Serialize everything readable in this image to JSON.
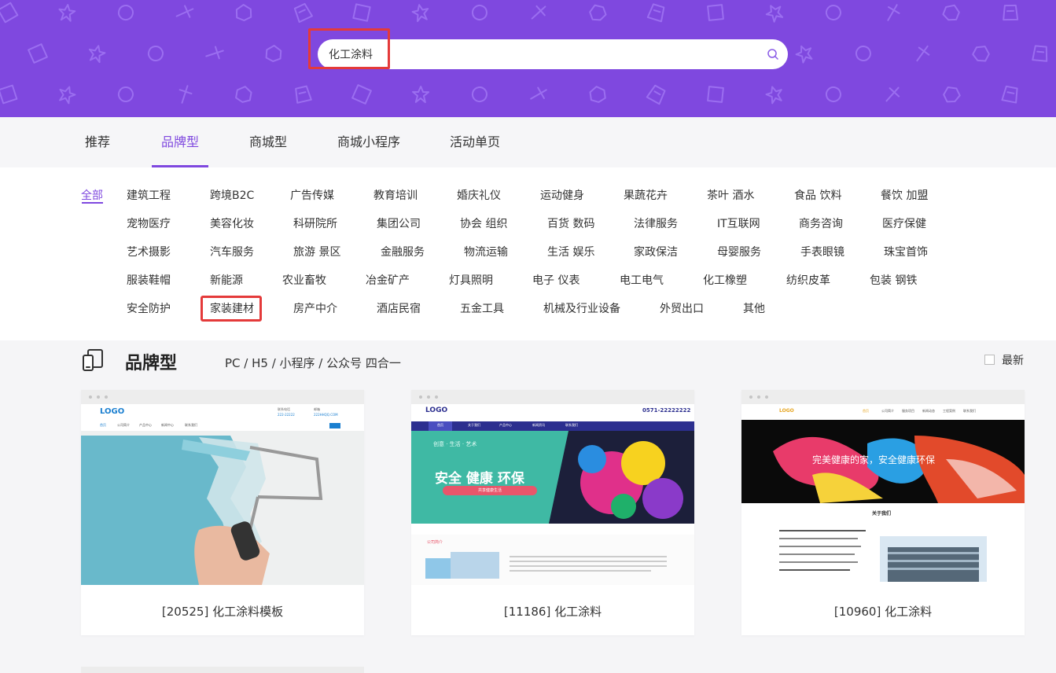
{
  "search": {
    "value": "化工涂料"
  },
  "tabs": [
    {
      "label": "推荐",
      "active": false
    },
    {
      "label": "品牌型",
      "active": true
    },
    {
      "label": "商城型",
      "active": false
    },
    {
      "label": "商城小程序",
      "active": false
    },
    {
      "label": "活动单页",
      "active": false
    }
  ],
  "categories": {
    "all": "全部",
    "rows": [
      [
        "建筑工程",
        "跨境B2C",
        "广告传媒",
        "教育培训",
        "婚庆礼仪",
        "运动健身",
        "果蔬花卉",
        "茶叶 酒水",
        "食品 饮料",
        "餐饮 加盟"
      ],
      [
        "宠物医疗",
        "美容化妆",
        "科研院所",
        "集团公司",
        "协会 组织",
        "百货 数码",
        "法律服务",
        "IT互联网",
        "商务咨询",
        "医疗保健"
      ],
      [
        "艺术摄影",
        "汽车服务",
        "旅游 景区",
        "金融服务",
        "物流运输",
        "生活 娱乐",
        "家政保洁",
        "母婴服务",
        "手表眼镜",
        "珠宝首饰"
      ],
      [
        "服装鞋帽",
        "新能源",
        "农业畜牧",
        "冶金矿产",
        "灯具照明",
        "电子 仪表",
        "电工电气",
        "化工橡塑",
        "纺织皮革",
        "包装 钢铁"
      ],
      [
        "安全防护",
        "家装建材",
        "房产中介",
        "酒店民宿",
        "五金工具",
        "机械及行业设备",
        "外贸出口",
        "其他"
      ]
    ]
  },
  "section": {
    "title": "品牌型",
    "subtitle": "PC / H5 / 小程序 / 公众号 四合一",
    "latest_label": "最新"
  },
  "cards": [
    {
      "caption": "[20525] 化工涂料模板",
      "preview": {
        "logo": "LOGO",
        "nav": [
          "首页",
          "公司简介",
          "产品中心",
          "新闻中心",
          "联系我们"
        ],
        "contact1_label": "联系电话",
        "contact1": "222-22222",
        "contact2_label": "邮箱",
        "contact2": "222HHQQ.COM"
      }
    },
    {
      "caption": "[11186] 化工涂料",
      "preview": {
        "logo": "LOGO",
        "phone": "0571-22222222",
        "nav": [
          "首页",
          "关于我们",
          "产品中心",
          "新闻资讯",
          "联系我们"
        ],
        "tagline": "创意 · 生活 · 艺术",
        "headline": "安全 健康 环保",
        "subline": "共享健康生活",
        "about": "公司简介"
      }
    },
    {
      "caption": "[10960] 化工涂料",
      "preview": {
        "logo": "LOGO",
        "nav": [
          "首页",
          "公司简介",
          "服务项目",
          "新闻动态",
          "工程案例",
          "联系我们"
        ],
        "slogan": "完美健康的家，安全健康环保",
        "about_title": "关于我们"
      }
    }
  ],
  "colors": {
    "brand": "#7f48df",
    "highlight": "#e43a3a",
    "text": "#333333"
  }
}
